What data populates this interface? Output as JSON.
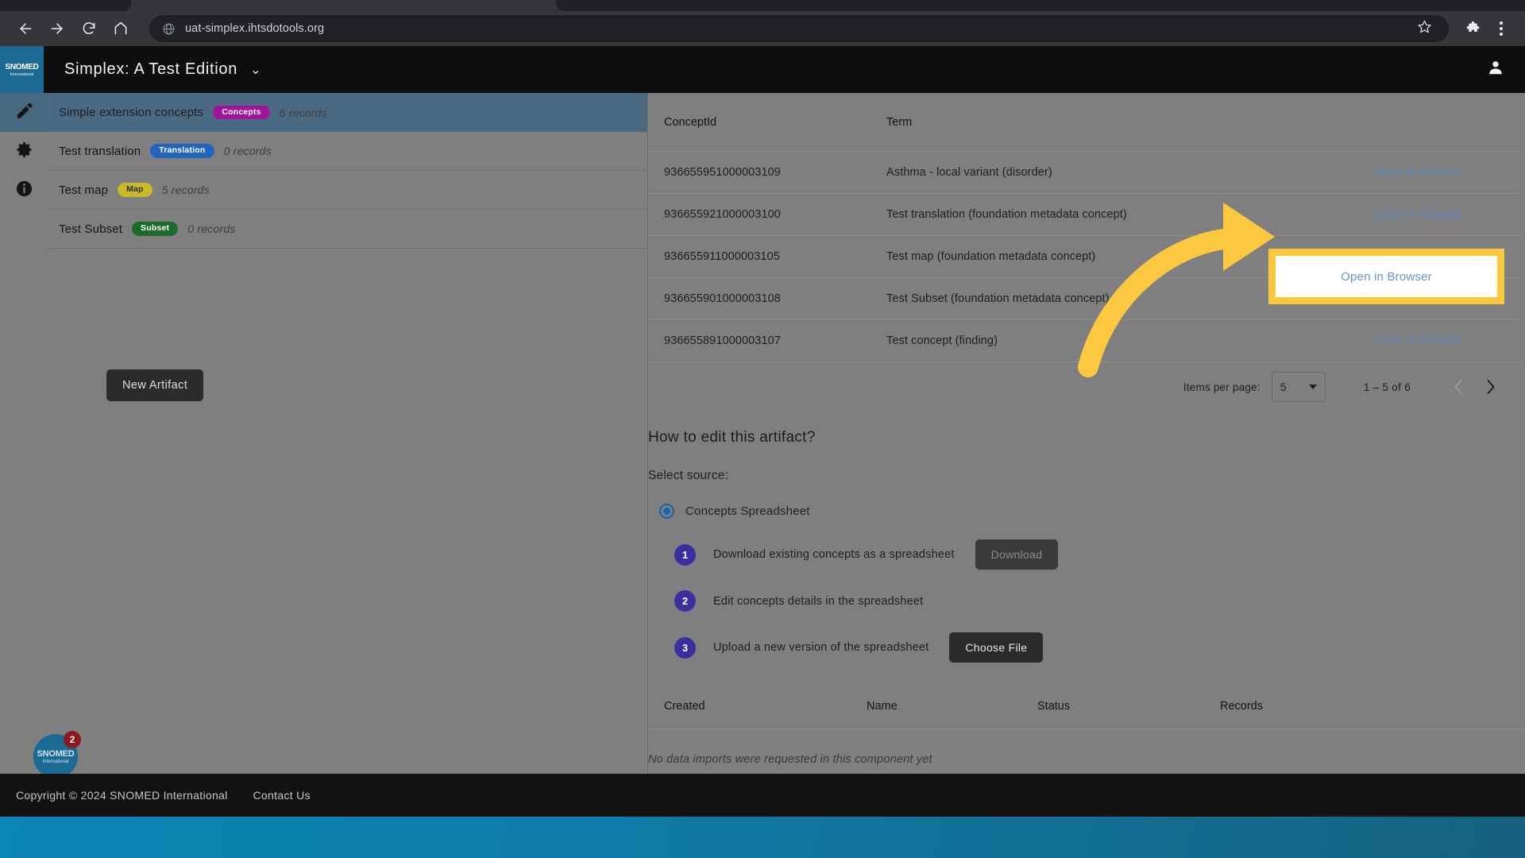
{
  "browser": {
    "url": "uat-simplex.ihtsdotools.org",
    "back_icon": "back-arrow-icon",
    "forward_icon": "forward-arrow-icon",
    "reload_icon": "reload-icon",
    "home_icon": "home-icon",
    "site_icon": "globe-icon",
    "bookmark_icon": "star-icon",
    "extensions_icon": "puzzle-icon",
    "menu_icon": "three-dot-menu-icon"
  },
  "app_header": {
    "logo_line1": "SNOMED",
    "logo_line2": "International",
    "title": "Simplex: A Test Edition",
    "caret": "⌄",
    "account_icon": "person-icon"
  },
  "left_rail": [
    {
      "name": "edit",
      "icon": "pencil-icon",
      "active": true
    },
    {
      "name": "settings",
      "icon": "gear-icon",
      "active": false
    },
    {
      "name": "info",
      "icon": "info-icon",
      "active": false
    }
  ],
  "artifacts": {
    "new_button_label": "New Artifact",
    "items": [
      {
        "name": "Simple extension concepts",
        "chip": "Concepts",
        "chip_type": "concepts",
        "records": "6 records",
        "selected": true
      },
      {
        "name": "Test translation",
        "chip": "Translation",
        "chip_type": "translation",
        "records": "0 records",
        "selected": false
      },
      {
        "name": "Test map",
        "chip": "Map",
        "chip_type": "map",
        "records": "5 records",
        "selected": false
      },
      {
        "name": "Test Subset",
        "chip": "Subset",
        "chip_type": "subset",
        "records": "0 records",
        "selected": false
      }
    ]
  },
  "concepts_table": {
    "headers": {
      "concept_id": "ConceptId",
      "term": "Term",
      "action": ""
    },
    "action_label": "Open in Browser",
    "rows": [
      {
        "concept_id": "936655951000003109",
        "term": "Asthma - local variant (disorder)",
        "action": "Open in Browser"
      },
      {
        "concept_id": "936655921000003100",
        "term": "Test translation (foundation metadata concept)",
        "action": "Open in Browser"
      },
      {
        "concept_id": "936655911000003105",
        "term": "Test map (foundation metadata concept)",
        "action": "Open in Browser"
      },
      {
        "concept_id": "936655901000003108",
        "term": "Test Subset (foundation metadata concept)",
        "action": "Open in Browser"
      },
      {
        "concept_id": "936655891000003107",
        "term": "Test concept (finding)",
        "action": "Open in Browser"
      }
    ]
  },
  "paginator": {
    "items_per_page_label": "Items per page:",
    "items_per_page_value": "5",
    "range_label": "1 – 5 of 6",
    "prev_icon": "chevron-left-icon",
    "next_icon": "chevron-right-icon"
  },
  "how_to_edit": {
    "title": "How to edit this artifact?",
    "select_source_label": "Select source:",
    "radio_label": "Concepts Spreadsheet",
    "steps": [
      {
        "num": "1",
        "text": "Download existing concepts as a spreadsheet",
        "button": "Download",
        "state": "disabled"
      },
      {
        "num": "2",
        "text": "Edit concepts details in the spreadsheet",
        "button": "",
        "state": "none"
      },
      {
        "num": "3",
        "text": "Upload a new version of the spreadsheet",
        "button": "Choose File",
        "state": "enabled"
      }
    ]
  },
  "imports_table": {
    "headers": {
      "created": "Created",
      "name": "Name",
      "status": "Status",
      "records": "Records"
    },
    "empty_message": "No data imports were requested in this component yet"
  },
  "support_badge": {
    "line1": "SNOMED",
    "line2": "International",
    "count": "2"
  },
  "footer": {
    "copyright": "Copyright © 2024 SNOMED International",
    "contact": "Contact Us"
  },
  "annotation": {
    "highlight_label": "Open in Browser",
    "highlight_color": "#fbc83f",
    "arrow_color": "#fbc83f"
  },
  "colors": {
    "accent_blue": "#1b6a94",
    "selected_row": "#4a6a83",
    "chip_concepts": "#a2129b",
    "chip_translation": "#2264bd",
    "chip_map": "#c9b92a",
    "chip_subset": "#1d6b2b",
    "step_badge": "#3b2fa0",
    "link_blue": "#5e88b5"
  }
}
